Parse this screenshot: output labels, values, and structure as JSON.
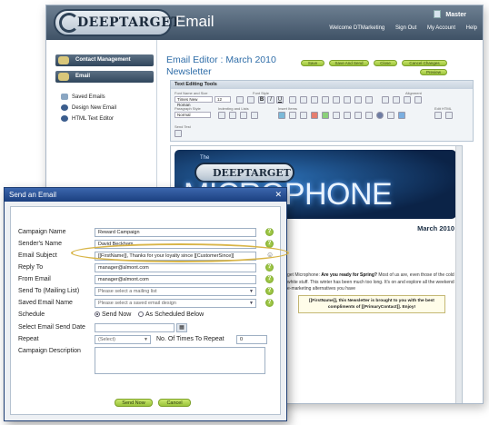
{
  "app": {
    "logo_text": "DEEPTARGET",
    "product": "Email",
    "user": "Master",
    "links": [
      "Welcome DTMarketing",
      "Sign Out",
      "My Account",
      "Help"
    ]
  },
  "sidebar": {
    "sections": [
      "Contact Management",
      "Email"
    ],
    "items": [
      "Saved Emails",
      "Design New Email",
      "HTML Text Editor"
    ]
  },
  "editor": {
    "title": "Email Editor : March 2010 Newsletter",
    "buttons": [
      "Save",
      "Save And Send",
      "Close",
      "Cancel Changes",
      "Preview"
    ],
    "tools_title": "Text Editing Tools",
    "font_name_label": "Font Name and Size",
    "font_style_label": "Font Style",
    "alignment_label": "Alignment",
    "paragraph_label": "Paragraph Style",
    "indent_label": "Indenting and Lists",
    "insert_label": "Insert Items",
    "edit_html_label": "Edit HTML",
    "font_name": "Times New Roman",
    "font_size": "12",
    "paragraph": "Normal",
    "send_test_label": "Send Test"
  },
  "newsletter": {
    "banner_brand": "DEEPTARGET",
    "banner_the": "The",
    "banner_word": "MICROPHONE",
    "date": "March 2010",
    "para_lead": "get Microphone:",
    "para_bold": "Are you ready for Spring?",
    "para_rest": "Most of us are, even those of the cold white stuff. This winter has been much too long. It's on and explore all the weekend e-marketing alternatives you have",
    "box_text": "[[FirstName]], this Newsletter is brought to you with the best compliments of [[PrimaryContact]]. Enjoy!"
  },
  "dialog": {
    "title": "Send an Email",
    "labels": {
      "campaign_name": "Campaign Name",
      "sender_name": "Sender's Name",
      "email_subject": "Email Subject",
      "reply_to": "Reply To",
      "from_email": "From Email",
      "send_to": "Send To (Mailing List)",
      "saved_email": "Saved Email Name",
      "schedule": "Schedule",
      "send_date": "Select Email Send Date",
      "repeat": "Repeat",
      "times_repeat": "No. Of Times To Repeat",
      "description": "Campaign Description"
    },
    "values": {
      "campaign_name": "Reward Campaign",
      "sender_name": "David Beckham",
      "email_subject": "[[FirstName]], Thanks for your loyalty since [[CustomerSince]]",
      "reply_to": "manager@almont.com",
      "from_email": "manager@almont.com",
      "send_to": "Please select a mailing list",
      "saved_email": "Please select a saved email design",
      "send_now": "Send Now",
      "as_scheduled": "As Scheduled Below",
      "repeat": "(Select)",
      "times_repeat": "0"
    },
    "buttons": {
      "send_now": "Send Now",
      "cancel": "Cancel"
    }
  },
  "colors": {
    "accent_green": "#9cc43b",
    "title_blue": "#2f6da8",
    "dialog_header": "#1b3f7f",
    "highlight": "#d8b548"
  }
}
